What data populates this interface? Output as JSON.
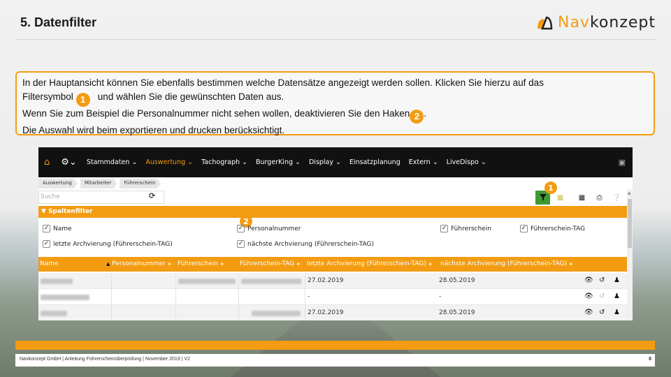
{
  "slide": {
    "title": "5. Datenfilter",
    "logo": {
      "prefix": "Nav",
      "suffix": "konzept"
    }
  },
  "info": {
    "line1": "In der Hauptansicht können Sie ebenfalls bestimmen welche Datensätze angezeigt werden sollen. Klicken Sie hierzu auf das",
    "line2_pre": "Filtersymbol",
    "badge1": "1",
    "line2_post": "und wählen Sie die gewünschten Daten aus.",
    "line3_pre": "Wenn Sie zum Beispiel die Personalnummer nicht sehen wollen, deaktivieren Sie den Haken",
    "badge2": "2",
    "line3_post": ".",
    "line4": "Die Auswahl wird beim exportieren und drucken berücksichtigt."
  },
  "app": {
    "nav": [
      "Stammdaten",
      "Auswertung",
      "Tachograph",
      "BurgerKing",
      "Display",
      "Einsatzplanung",
      "Extern",
      "LiveDispo"
    ],
    "breadcrumb": [
      "Auswertung",
      "Mitarbeiter",
      "Führerschein"
    ],
    "search_placeholder": "Suche",
    "filter_bar": "Spaltenfilter",
    "checkboxes": [
      "Name",
      "Personalnummer",
      "Führerschein",
      "Führerschein-TAG",
      "letzte Archvierung (Führerschein-TAG)",
      "nächste Archvierung (Führerschein-TAG)"
    ],
    "columns": [
      "Name",
      "Personalnummer",
      "Führerschein",
      "Führerschein-TAG",
      "letzte Archvierung (Führerschein-TAG)",
      "nächste Archvierung (Führerschein-TAG)"
    ],
    "rows": [
      {
        "last": "27.02.2019",
        "next": "28.05.2019"
      },
      {
        "last": "-",
        "next": "-"
      },
      {
        "last": "27.02.2019",
        "next": "28.05.2019"
      }
    ],
    "badge1": "1",
    "badge2": "2"
  },
  "footer": {
    "text": "Navkonzept GmbH  |  Anleitung Führerscheinüberprüfung  |  November 2019  |  V2",
    "page": "8"
  },
  "colors": {
    "accent": "#f39c12",
    "filter_button": "#3d9a33",
    "nav_bg": "#111111"
  }
}
